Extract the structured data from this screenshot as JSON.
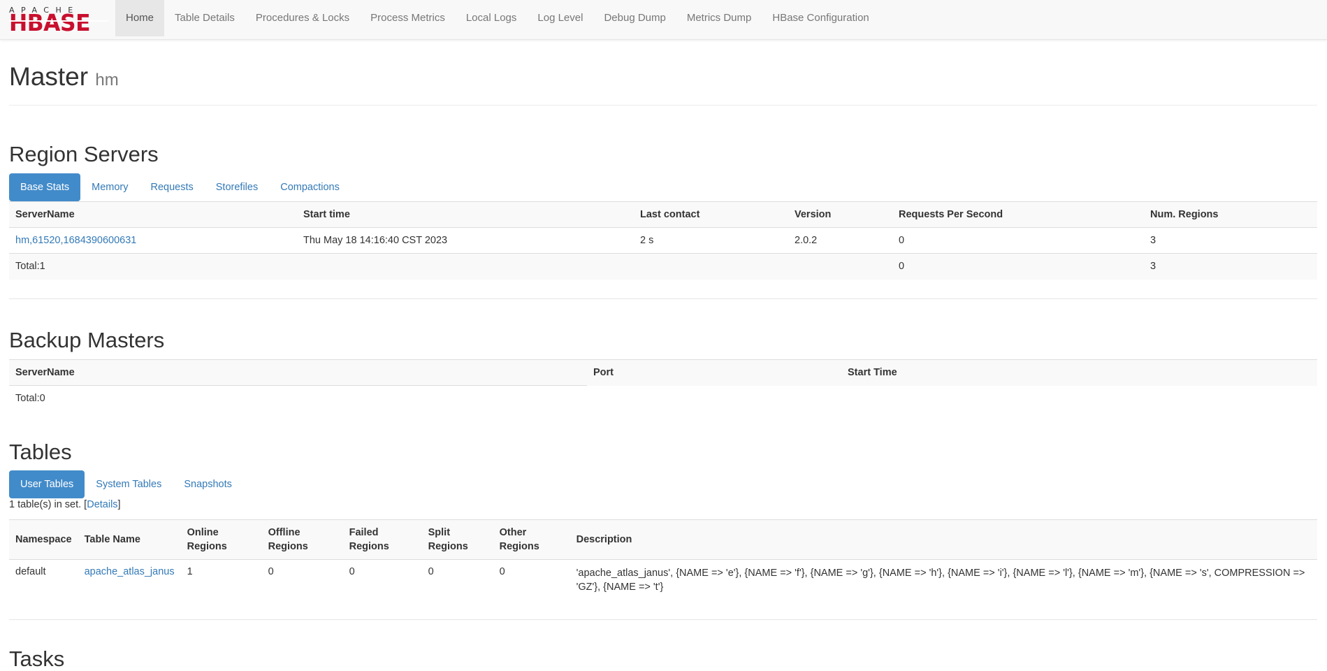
{
  "logo": {
    "top": "APACHE",
    "main": "HBASE"
  },
  "nav": [
    {
      "label": "Home",
      "active": true
    },
    {
      "label": "Table Details"
    },
    {
      "label": "Procedures & Locks"
    },
    {
      "label": "Process Metrics"
    },
    {
      "label": "Local Logs"
    },
    {
      "label": "Log Level"
    },
    {
      "label": "Debug Dump"
    },
    {
      "label": "Metrics Dump"
    },
    {
      "label": "HBase Configuration"
    }
  ],
  "header": {
    "title": "Master",
    "subtitle": "hm"
  },
  "region_servers": {
    "title": "Region Servers",
    "tabs": [
      "Base Stats",
      "Memory",
      "Requests",
      "Storefiles",
      "Compactions"
    ],
    "columns": [
      "ServerName",
      "Start time",
      "Last contact",
      "Version",
      "Requests Per Second",
      "Num. Regions"
    ],
    "rows": [
      {
        "server": "hm,61520,1684390600631",
        "start": "Thu May 18 14:16:40 CST 2023",
        "contact": "2 s",
        "version": "2.0.2",
        "rps": "0",
        "regions": "3"
      }
    ],
    "total": {
      "label": "Total:1",
      "rps": "0",
      "regions": "3"
    }
  },
  "backup_masters": {
    "title": "Backup Masters",
    "columns": [
      "ServerName",
      "Port",
      "Start Time"
    ],
    "total": "Total:0"
  },
  "tables": {
    "title": "Tables",
    "tabs": [
      "User Tables",
      "System Tables",
      "Snapshots"
    ],
    "count_text": "1 table(s) in set. [",
    "details_link": "Details",
    "count_close": "]",
    "columns": [
      "Namespace",
      "Table Name",
      "Online Regions",
      "Offline Regions",
      "Failed Regions",
      "Split Regions",
      "Other Regions",
      "Description"
    ],
    "rows": [
      {
        "namespace": "default",
        "name": "apache_atlas_janus",
        "online": "1",
        "offline": "0",
        "failed": "0",
        "split": "0",
        "other": "0",
        "description": "'apache_atlas_janus', {NAME => 'e'}, {NAME => 'f'}, {NAME => 'g'}, {NAME => 'h'}, {NAME => 'i'}, {NAME => 'l'}, {NAME => 'm'}, {NAME => 's', COMPRESSION => 'GZ'}, {NAME => 't'}"
      }
    ]
  },
  "tasks": {
    "title": "Tasks"
  }
}
